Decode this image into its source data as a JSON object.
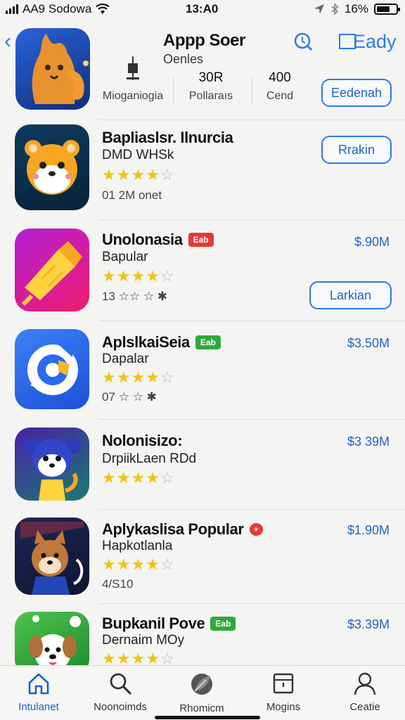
{
  "status_bar": {
    "carrier": "AA9 Sodowa",
    "time": "13:A0",
    "battery": "16%"
  },
  "header": {
    "title": "Appp Soer",
    "subtitle": "Oenles",
    "ready_label": "Eady",
    "stats": [
      {
        "value": "",
        "label": "Mioganiogia"
      },
      {
        "value": "30R",
        "label": "Pollaraıs"
      },
      {
        "value": "400",
        "label": "Cend"
      }
    ],
    "action_label": "Eedenah"
  },
  "apps": [
    {
      "title": "Bapliaslsr. Ilnurcia",
      "badge": "",
      "subtitle": "DMD WHSk",
      "rating": 4,
      "meta": "01 2M  onet",
      "price": "",
      "button": "Rrakin"
    },
    {
      "title": "Unolonasia",
      "badge": "Eab",
      "subtitle": "Bapular",
      "rating": 4,
      "meta": "13 ☆☆ ☆ ✱",
      "price": "$.90M",
      "button": "Larkian"
    },
    {
      "title": "AplslkaiSeia",
      "badge": "Eab",
      "subtitle": "Dapalar",
      "rating": 4,
      "meta": "07 ☆ ☆ ✱",
      "price": "$3.50M",
      "button": ""
    },
    {
      "title": "Nolonisizo:",
      "badge": "",
      "subtitle": "DrpiikLaen RDd",
      "rating": 4,
      "meta": "",
      "price": "$3 39M",
      "button": ""
    },
    {
      "title": "Aplykaslisa Popular",
      "badge": "+",
      "subtitle": "Hapkotlanla",
      "rating": 4,
      "meta": "4/S10",
      "price": "$1.90M",
      "button": ""
    },
    {
      "title": "Bupkanil Pove",
      "badge": "Eab",
      "subtitle": "Dernaim MOy",
      "rating": 4,
      "meta": "",
      "price": "$3.39M",
      "button": ""
    }
  ],
  "tabs": [
    {
      "label": "Intulanet",
      "icon": "home-icon"
    },
    {
      "label": "Noonoimds",
      "icon": "search-icon"
    },
    {
      "label": "Rhomicm",
      "icon": "leaf-icon"
    },
    {
      "label": "Mogins",
      "icon": "calendar-icon"
    },
    {
      "label": "Ceatie",
      "icon": "profile-icon"
    }
  ],
  "colors": {
    "accent": "#2c7be5",
    "star": "#f1c40f",
    "badge_red": "#e53935",
    "badge_green": "#2eaa3c"
  }
}
